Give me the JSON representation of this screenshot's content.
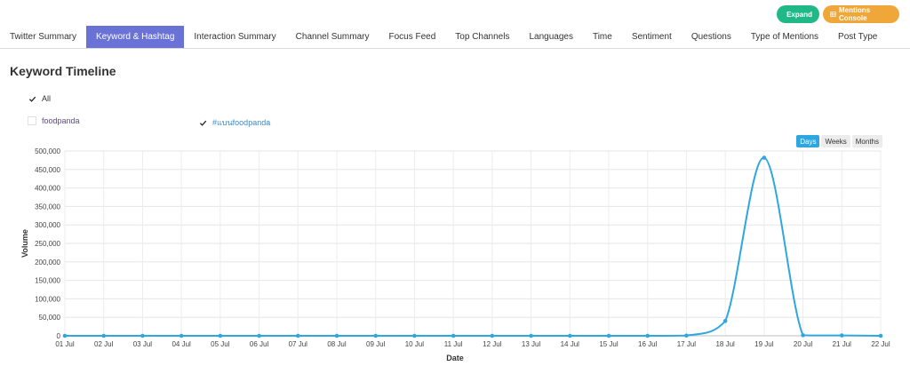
{
  "actions": {
    "expand_label": "Expand",
    "mentions_label": "Mentions Console"
  },
  "tabs": [
    {
      "label": "Twitter Summary",
      "active": false
    },
    {
      "label": "Keyword & Hashtag",
      "active": true
    },
    {
      "label": "Interaction Summary",
      "active": false
    },
    {
      "label": "Channel Summary",
      "active": false
    },
    {
      "label": "Focus Feed",
      "active": false
    },
    {
      "label": "Top Channels",
      "active": false
    },
    {
      "label": "Languages",
      "active": false
    },
    {
      "label": "Time",
      "active": false
    },
    {
      "label": "Sentiment",
      "active": false
    },
    {
      "label": "Questions",
      "active": false
    },
    {
      "label": "Type of Mentions",
      "active": false
    },
    {
      "label": "Post Type",
      "active": false
    }
  ],
  "section": {
    "title": "Keyword Timeline"
  },
  "filters": {
    "all": {
      "label": "All",
      "checked": true
    },
    "items": [
      {
        "label": "foodpanda",
        "checked": false
      },
      {
        "label": "#แบนfoodpanda",
        "checked": true
      }
    ]
  },
  "range_buttons": [
    {
      "label": "Days",
      "active": true
    },
    {
      "label": "Weeks",
      "active": false
    },
    {
      "label": "Months",
      "active": false
    }
  ],
  "colors": {
    "accent_tab": "#6a72d6",
    "series_line": "#2fa6e0",
    "expand": "#1fb886",
    "mentions": "#f0a73a"
  },
  "chart_data": {
    "type": "line",
    "xlabel": "Date",
    "ylabel": "Volume",
    "ylim": [
      0,
      500000
    ],
    "yticks": [
      "0",
      "50,000",
      "100,000",
      "150,000",
      "200,000",
      "250,000",
      "300,000",
      "350,000",
      "400,000",
      "450,000",
      "500,000"
    ],
    "ytick_values": [
      0,
      50000,
      100000,
      150000,
      200000,
      250000,
      300000,
      350000,
      400000,
      450000,
      500000
    ],
    "categories": [
      "01 Jul",
      "02 Jul",
      "03 Jul",
      "04 Jul",
      "05 Jul",
      "06 Jul",
      "07 Jul",
      "08 Jul",
      "09 Jul",
      "10 Jul",
      "11 Jul",
      "12 Jul",
      "13 Jul",
      "14 Jul",
      "15 Jul",
      "16 Jul",
      "17 Jul",
      "18 Jul",
      "19 Jul",
      "20 Jul",
      "21 Jul",
      "22 Jul"
    ],
    "grid": true,
    "series": [
      {
        "values": [
          0,
          0,
          0,
          0,
          0,
          0,
          0,
          0,
          0,
          0,
          0,
          0,
          0,
          0,
          0,
          0,
          500,
          40000,
          482000,
          1500,
          1000,
          0
        ]
      }
    ]
  }
}
